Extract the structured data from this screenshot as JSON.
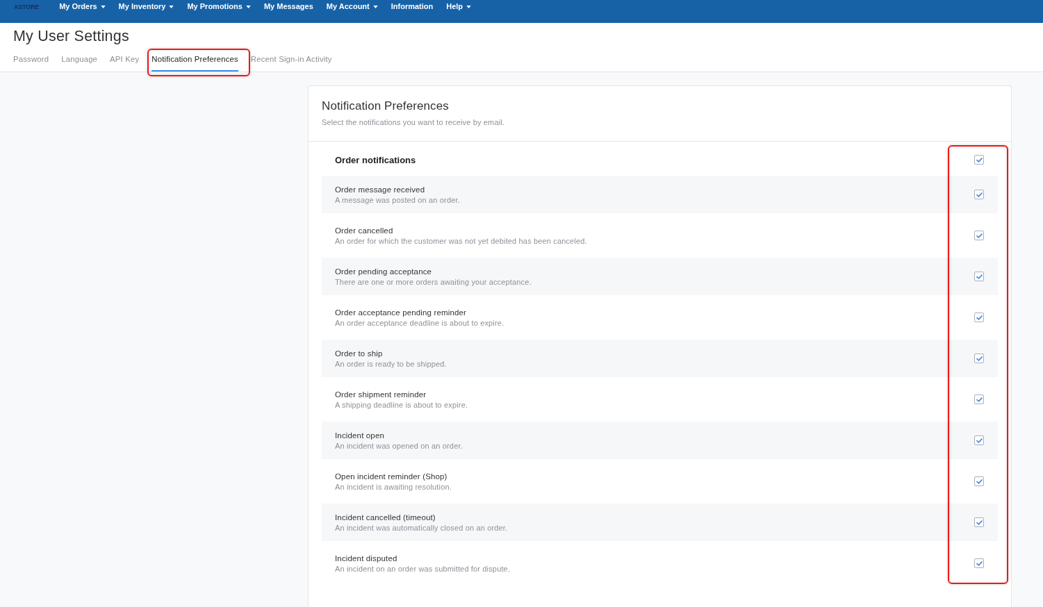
{
  "navbar": {
    "logo": "ASTORE",
    "items": [
      {
        "label": "My Orders",
        "dropdown": true
      },
      {
        "label": "My Inventory",
        "dropdown": true
      },
      {
        "label": "My Promotions",
        "dropdown": true
      },
      {
        "label": "My Messages",
        "dropdown": false
      },
      {
        "label": "My Account",
        "dropdown": true
      },
      {
        "label": "Information",
        "dropdown": false
      },
      {
        "label": "Help",
        "dropdown": true
      }
    ]
  },
  "page_title": "My User Settings",
  "tabs": [
    {
      "label": "Password",
      "selected": false,
      "highlighted": false
    },
    {
      "label": "Language",
      "selected": false,
      "highlighted": false
    },
    {
      "label": "API Key",
      "selected": false,
      "highlighted": false
    },
    {
      "label": "Notification Preferences",
      "selected": true,
      "highlighted": true
    },
    {
      "label": "Recent Sign-in Activity",
      "selected": false,
      "highlighted": false
    }
  ],
  "panel": {
    "title": "Notification Preferences",
    "subtitle": "Select the notifications you want to receive by email.",
    "checkbox_column_highlighted": true,
    "section": {
      "title": "Order notifications",
      "checked": true
    },
    "items": [
      {
        "title": "Order message received",
        "description": "A message was posted on an order.",
        "checked": true
      },
      {
        "title": "Order cancelled",
        "description": "An order for which the customer was not yet debited has been canceled.",
        "checked": true
      },
      {
        "title": "Order pending acceptance",
        "description": "There are one or more orders awaiting your acceptance.",
        "checked": true
      },
      {
        "title": "Order acceptance pending reminder",
        "description": "An order acceptance deadline is about to expire.",
        "checked": true
      },
      {
        "title": "Order to ship",
        "description": "An order is ready to be shipped.",
        "checked": true
      },
      {
        "title": "Order shipment reminder",
        "description": "A shipping deadline is about to expire.",
        "checked": true
      },
      {
        "title": "Incident open",
        "description": "An incident was opened on an order.",
        "checked": true
      },
      {
        "title": "Open incident reminder (Shop)",
        "description": "An incident is awaiting resolution.",
        "checked": true
      },
      {
        "title": "Incident cancelled (timeout)",
        "description": "An incident was automatically closed on an order.",
        "checked": true
      },
      {
        "title": "Incident disputed",
        "description": "An incident on an order was submitted for dispute.",
        "checked": true
      }
    ]
  }
}
